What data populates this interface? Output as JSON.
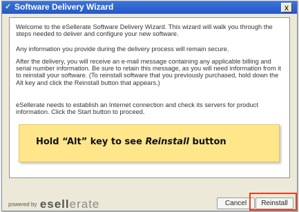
{
  "window": {
    "title": "Software Delivery Wizard",
    "close_label": "x"
  },
  "content": {
    "paragraph_1": "Welcome to the eSellerate Software Delivery Wizard. This wizard will walk you through the steps needed to deliver and configure your new software.",
    "paragraph_2": "Any information you provide during the delivery process will remain secure.",
    "paragraph_3": "After the delivery, you will receive an e-mail message containing any applicable billing and serial number information. Be sure to retain this message, as you will need information from it to reinstall your software. (To reinstall software that you previously purchased, hold down the Alt key and click the Reinstall button that appears.)",
    "paragraph_4": "eSellerate needs to establish an Internet connection and check its servers for product information. Click the Start button to proceed."
  },
  "callout": {
    "prefix": "Hold “Alt” key to see ",
    "emphasis": "Reinstall",
    "suffix": " button"
  },
  "footer": {
    "powered_by": "powered by",
    "brand_part_1": "esell",
    "brand_part_2": "erate",
    "cancel_label": "Cancel",
    "reinstall_label": "Reinstall"
  },
  "colors": {
    "titlebar": "#2557c9",
    "callout": "#ffe68b",
    "highlight": "#f13b1b"
  }
}
